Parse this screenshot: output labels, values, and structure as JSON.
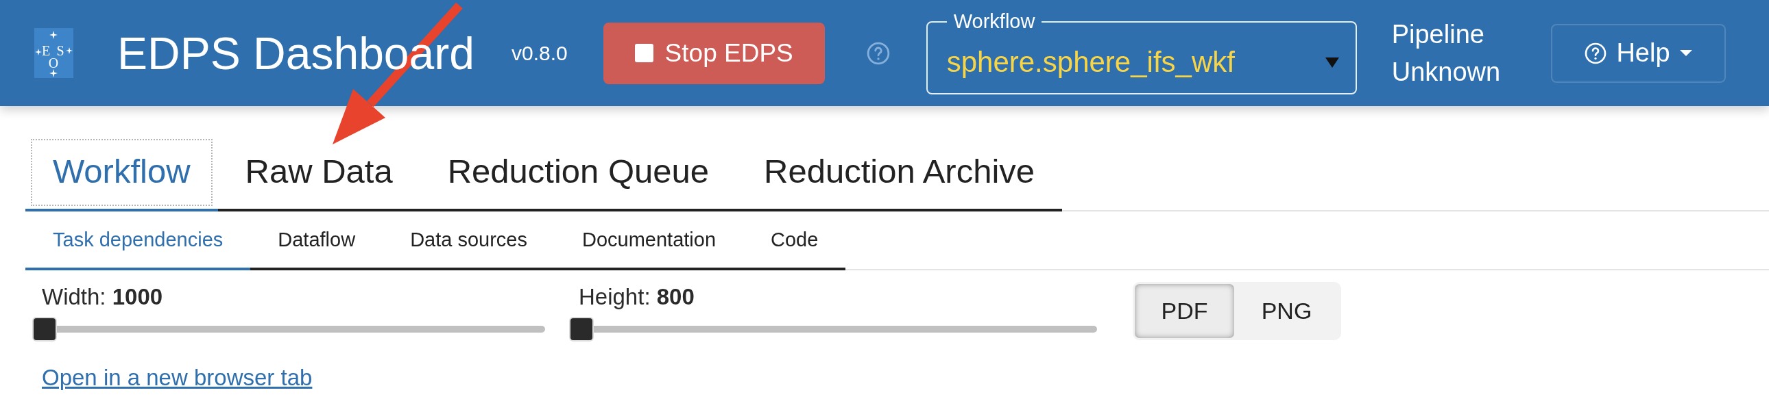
{
  "header": {
    "logo": {
      "letters": [
        "E",
        "S",
        "O"
      ]
    },
    "title": "EDPS Dashboard",
    "version": "v0.8.0",
    "stop_button": {
      "label": "Stop EDPS"
    },
    "workflow_select": {
      "legend": "Workflow",
      "value": "sphere.sphere_ifs_wkf"
    },
    "pipeline_status": "Pipeline Unknown",
    "help_button": {
      "label": "Help"
    }
  },
  "tabs": [
    {
      "label": "Workflow",
      "selected": true
    },
    {
      "label": "Raw Data",
      "selected": false
    },
    {
      "label": "Reduction Queue",
      "selected": false
    },
    {
      "label": "Reduction Archive",
      "selected": false
    }
  ],
  "subtabs": [
    {
      "label": "Task dependencies",
      "selected": true
    },
    {
      "label": "Dataflow",
      "selected": false
    },
    {
      "label": "Data sources",
      "selected": false
    },
    {
      "label": "Documentation",
      "selected": false
    },
    {
      "label": "Code",
      "selected": false
    }
  ],
  "sliders": [
    {
      "label": "Width: **1000**",
      "level": 0
    },
    {
      "label": "Height: **800**",
      "level": 0
    }
  ],
  "format_toggle": [
    {
      "label": "PDF",
      "selected": true
    },
    {
      "label": "PNG",
      "selected": false
    }
  ],
  "link": "Open in a new browser tab",
  "annotations": [
    {
      "kind": "arrow"
    }
  ]
}
